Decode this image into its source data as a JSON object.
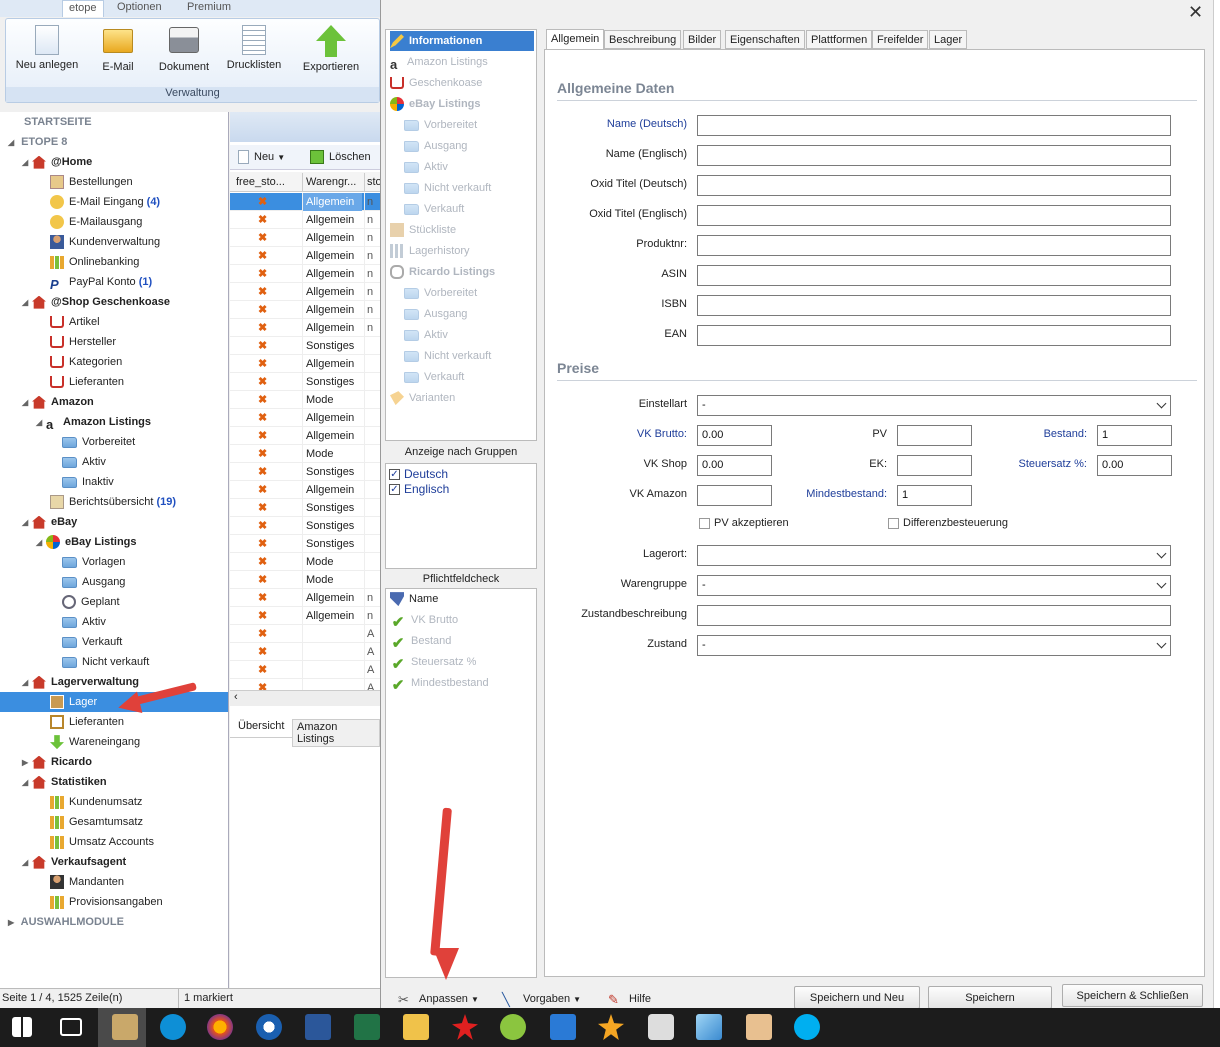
{
  "ribbon": {
    "tabs": [
      "etope",
      "Optionen",
      "Premium"
    ],
    "buttons": [
      "Neu anlegen",
      "E-Mail",
      "Dokument",
      "Drucklisten",
      "Exportieren"
    ],
    "group": "Verwaltung"
  },
  "tree": {
    "startseite": "STARTSEITE",
    "etope": "ETOPE 8",
    "home": "@Home",
    "bestellungen": "Bestellungen",
    "mail_in": "E-Mail Eingang",
    "mail_in_count": "(4)",
    "mail_out": "E-Mailausgang",
    "kunden": "Kundenverwaltung",
    "online": "Onlinebanking",
    "paypal": "PayPal Konto",
    "paypal_count": "(1)",
    "shop": "@Shop Geschenkoase",
    "artikel": "Artikel",
    "hersteller": "Hersteller",
    "kategorien": "Kategorien",
    "lieferanten": "Lieferanten",
    "amazon": "Amazon",
    "amazon_listings": "Amazon Listings",
    "vorbereitet": "Vorbereitet",
    "aktiv": "Aktiv",
    "inaktiv": "Inaktiv",
    "berichte": "Berichtsübersicht",
    "berichte_count": "(19)",
    "ebay": "eBay",
    "ebay_listings": "eBay Listings",
    "vorlagen": "Vorlagen",
    "ausgang": "Ausgang",
    "geplant": "Geplant",
    "aktiv2": "Aktiv",
    "verkauft": "Verkauft",
    "nicht_verkauft": "Nicht verkauft",
    "lagerverwaltung": "Lagerverwaltung",
    "lager": "Lager",
    "lieferanten2": "Lieferanten",
    "wareneingang": "Wareneingang",
    "ricardo": "Ricardo",
    "statistiken": "Statistiken",
    "kundenumsatz": "Kundenumsatz",
    "gesamtumsatz": "Gesamtumsatz",
    "umsatz_accounts": "Umsatz Accounts",
    "verkaufsagent": "Verkaufsagent",
    "mandanten": "Mandanten",
    "provision": "Provisionsangaben",
    "auswahl": "AUSWAHLMODULE"
  },
  "grid": {
    "new_label": "Neu",
    "delete_label": "Löschen",
    "columns": [
      "free_sto...",
      "Warengr...",
      "sto"
    ],
    "rows": [
      "Allgemein",
      "Allgemein",
      "Allgemein",
      "Allgemein",
      "Allgemein",
      "Allgemein",
      "Allgemein",
      "Allgemein",
      "Sonstiges",
      "Allgemein",
      "Sonstiges",
      "Mode",
      "Allgemein",
      "Allgemein",
      "Mode",
      "Sonstiges",
      "Allgemein",
      "Sonstiges",
      "Sonstiges",
      "Sonstiges",
      "Mode",
      "Mode",
      "Allgemein",
      "Allgemein",
      "",
      "",
      "",
      ""
    ],
    "col3": [
      "n",
      "n",
      "n",
      "n",
      "n",
      "n",
      "n",
      "n",
      "",
      "",
      "",
      "",
      "",
      "",
      "",
      "",
      "",
      "",
      "",
      "",
      "",
      "",
      "n",
      "n",
      "A",
      "A",
      "A",
      "A"
    ],
    "tabs": [
      "Übersicht",
      "Amazon Listings"
    ]
  },
  "status": {
    "page": "Seite 1 / 4, 1525 Zeile(n)",
    "marked": "1 markiert"
  },
  "dialog": {
    "nav": [
      "Informationen",
      "Amazon Listings",
      "Geschenkoase",
      "eBay Listings",
      "Vorbereitet",
      "Ausgang",
      "Aktiv",
      "Nicht verkauft",
      "Verkauft",
      "Stückliste",
      "Lagerhistory",
      "Ricardo Listings",
      "Vorbereitet",
      "Ausgang",
      "Aktiv",
      "Nicht verkauft",
      "Verkauft",
      "Varianten"
    ],
    "groups_title": "Anzeige nach Gruppen",
    "groups": [
      "Deutsch",
      "Englisch"
    ],
    "pflicht_title": "Pflichtfeldcheck",
    "pflicht": [
      "Name",
      "VK Brutto",
      "Bestand",
      "Steuersatz %",
      "Mindestbestand"
    ],
    "tabs": [
      "Allgemein",
      "Beschreibung",
      "Bilder",
      "Eigenschaften",
      "Plattformen",
      "Freifelder",
      "Lager"
    ],
    "section_general": "Allgemeine Daten",
    "fields": [
      "Name (Deutsch)",
      "Name (Englisch)",
      "Oxid Titel (Deutsch)",
      "Oxid Titel (Englisch)",
      "Produktnr:",
      "ASIN",
      "ISBN",
      "EAN"
    ],
    "section_prices": "Preise",
    "einstellart": "Einstellart",
    "einstellart_value": "-",
    "vk_brutto": "VK Brutto:",
    "vk_brutto_value": "0.00",
    "pv": "PV",
    "bestand": "Bestand:",
    "bestand_value": "1",
    "vk_shop": "VK Shop",
    "vk_shop_value": "0.00",
    "ek": "EK:",
    "steuersatz": "Steuersatz %:",
    "steuersatz_value": "0.00",
    "vk_amazon": "VK Amazon",
    "mindestbestand": "Mindestbestand:",
    "mindestbestand_value": "1",
    "pv_akzeptieren": "PV akzeptieren",
    "differenz": "Differenzbesteuerung",
    "lagerort": "Lagerort:",
    "warengruppe": "Warengruppe",
    "warengruppe_value": "-",
    "zustandbeschreibung": "Zustandbeschreibung",
    "zustand": "Zustand",
    "zustand_value": "-",
    "anpassen": "Anpassen",
    "vorgaben": "Vorgaben",
    "hilfe": "Hilfe",
    "save_new": "Speichern und Neu",
    "save": "Speichern",
    "save_close": "Speichern & Schließen"
  },
  "colors": {
    "accent": "#3b8ee0",
    "arrow": "#e0413a",
    "label_blue": "#1f3e9a"
  }
}
